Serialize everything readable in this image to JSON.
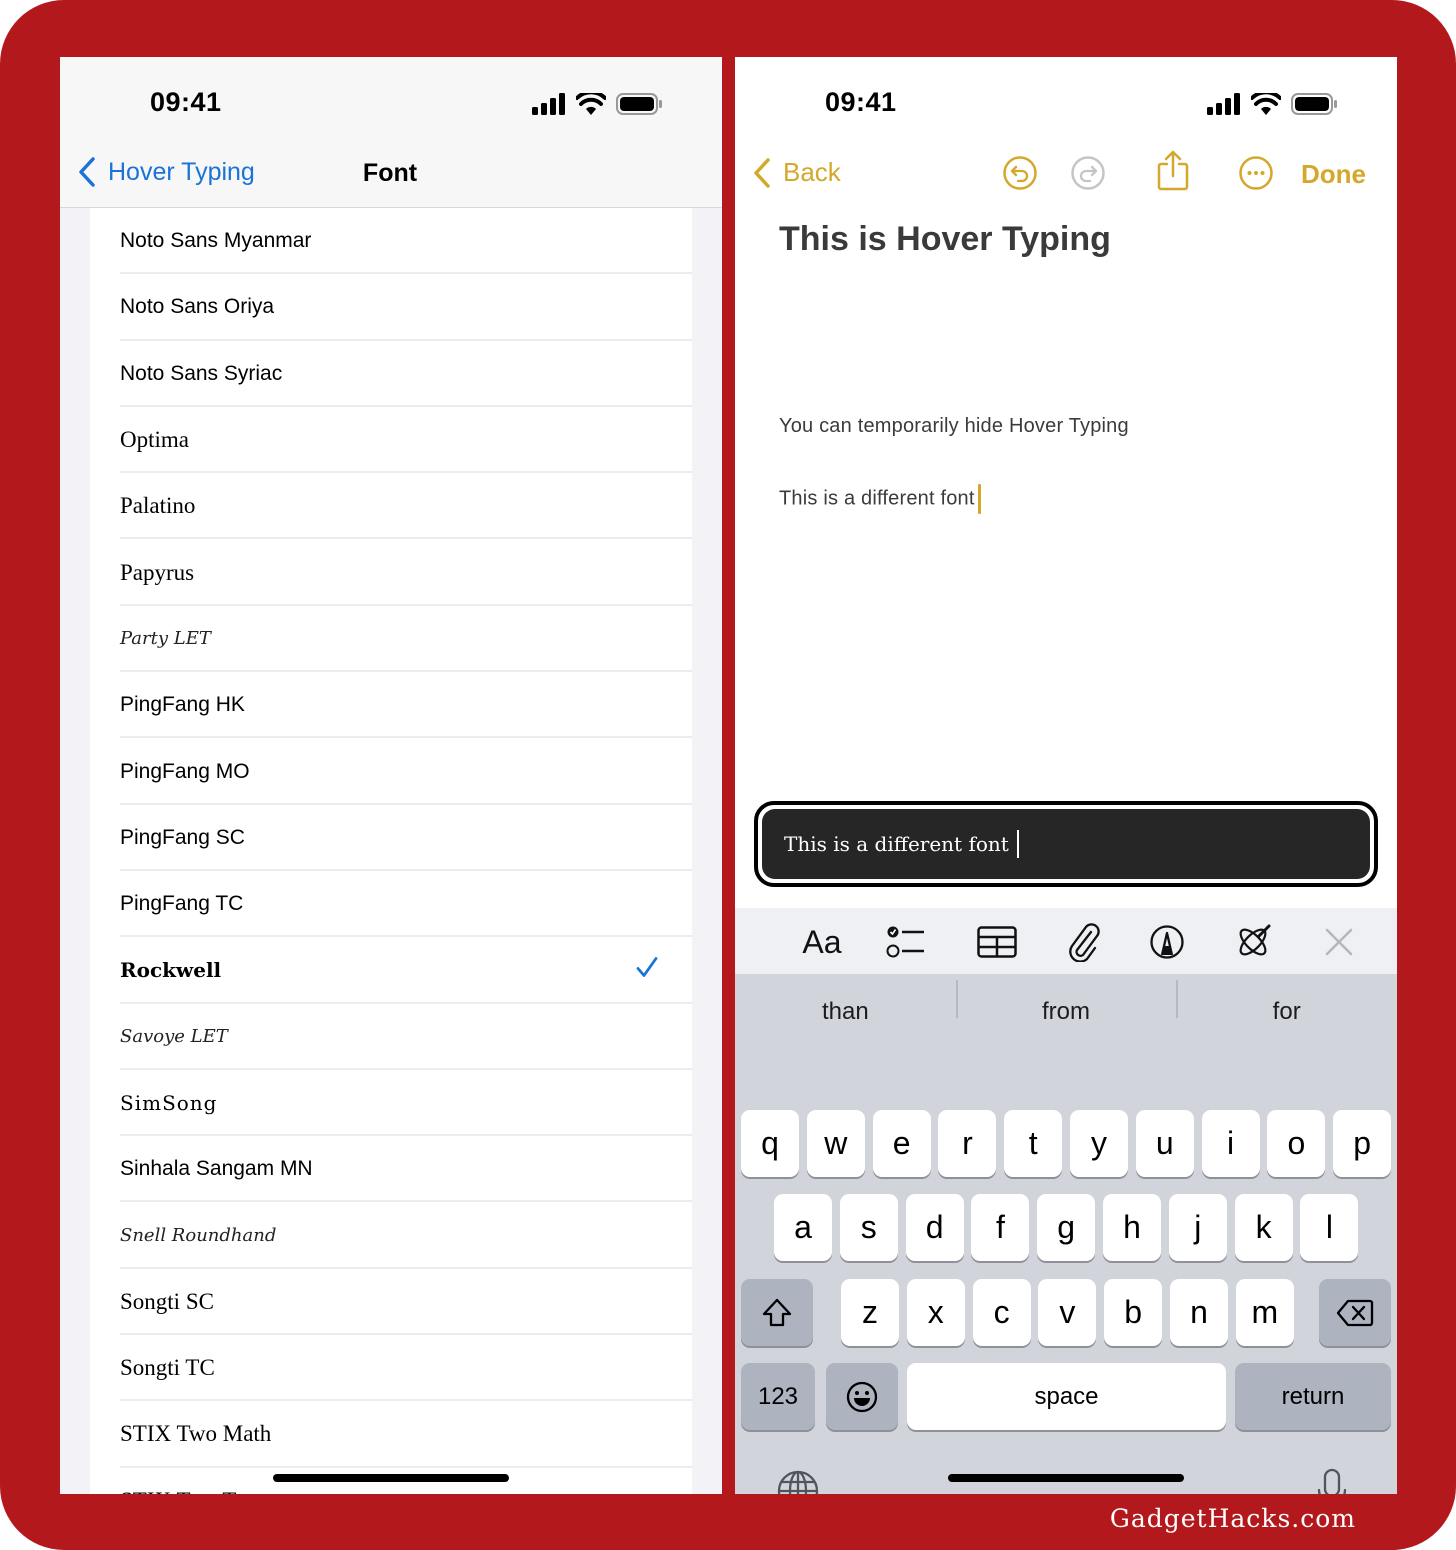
{
  "left_screen": {
    "status_bar": {
      "time": "09:41",
      "icons": [
        "cellular-signal-icon",
        "wifi-icon",
        "battery-icon"
      ]
    },
    "nav": {
      "back_label": "Hover Typing",
      "title": "Font"
    },
    "font_list": [
      {
        "label": "Noto Sans Myanmar",
        "style": "sans",
        "selected": false
      },
      {
        "label": "Noto Sans Oriya",
        "style": "sans",
        "selected": false
      },
      {
        "label": "Noto Sans Syriac",
        "style": "sans",
        "selected": false
      },
      {
        "label": "Optima",
        "style": "serif",
        "selected": false
      },
      {
        "label": "Palatino",
        "style": "serif",
        "selected": false
      },
      {
        "label": "Papyrus",
        "style": "serif",
        "selected": false
      },
      {
        "label": "Party LET",
        "style": "italic",
        "selected": false
      },
      {
        "label": "PingFang HK",
        "style": "sans",
        "selected": false
      },
      {
        "label": "PingFang MO",
        "style": "sans",
        "selected": false
      },
      {
        "label": "PingFang SC",
        "style": "sans",
        "selected": false
      },
      {
        "label": "PingFang TC",
        "style": "sans",
        "selected": false
      },
      {
        "label": "Rockwell",
        "style": "rock",
        "selected": true
      },
      {
        "label": "Savoye LET",
        "style": "italic",
        "selected": false
      },
      {
        "label": "SimSong",
        "style": "mono",
        "selected": false
      },
      {
        "label": "Sinhala Sangam MN",
        "style": "sans",
        "selected": false
      },
      {
        "label": "Snell Roundhand",
        "style": "italic",
        "selected": false
      },
      {
        "label": "Songti SC",
        "style": "serif",
        "selected": false
      },
      {
        "label": "Songti TC",
        "style": "serif",
        "selected": false
      },
      {
        "label": "STIX Two Math",
        "style": "serif",
        "selected": false
      },
      {
        "label": "STIX Two Text",
        "style": "serif",
        "selected": false
      }
    ],
    "accent_color": "#1a73d9"
  },
  "right_screen": {
    "status_bar": {
      "time": "09:41",
      "icons": [
        "cellular-signal-icon",
        "wifi-icon",
        "battery-icon"
      ]
    },
    "toolbar": {
      "back_label": "Back",
      "done_label": "Done",
      "icons": [
        "undo-icon",
        "redo-icon",
        "share-icon",
        "more-icon"
      ]
    },
    "note": {
      "title": "This is Hover Typing",
      "lines": [
        "You can temporarily hide Hover Typing",
        "This is a different font"
      ]
    },
    "hover_typing_text": "This is a different font",
    "format_bar": [
      "text-format-icon",
      "checklist-icon",
      "table-icon",
      "attachment-icon",
      "markup-icon",
      "apple-intelligence-icon",
      "close-icon"
    ],
    "format_bar_text_label": "Aa",
    "suggestions": [
      "than",
      "from",
      "for"
    ],
    "keyboard": {
      "row1": [
        "q",
        "w",
        "e",
        "r",
        "t",
        "y",
        "u",
        "i",
        "o",
        "p"
      ],
      "row2": [
        "a",
        "s",
        "d",
        "f",
        "g",
        "h",
        "j",
        "k",
        "l"
      ],
      "row3": [
        "z",
        "x",
        "c",
        "v",
        "b",
        "n",
        "m"
      ],
      "numbers_label": "123",
      "space_label": "space",
      "return_label": "return"
    },
    "accent_color": "#d4a82a"
  },
  "watermark": "GadgetHacks.com",
  "frame_color": "#b3191c"
}
